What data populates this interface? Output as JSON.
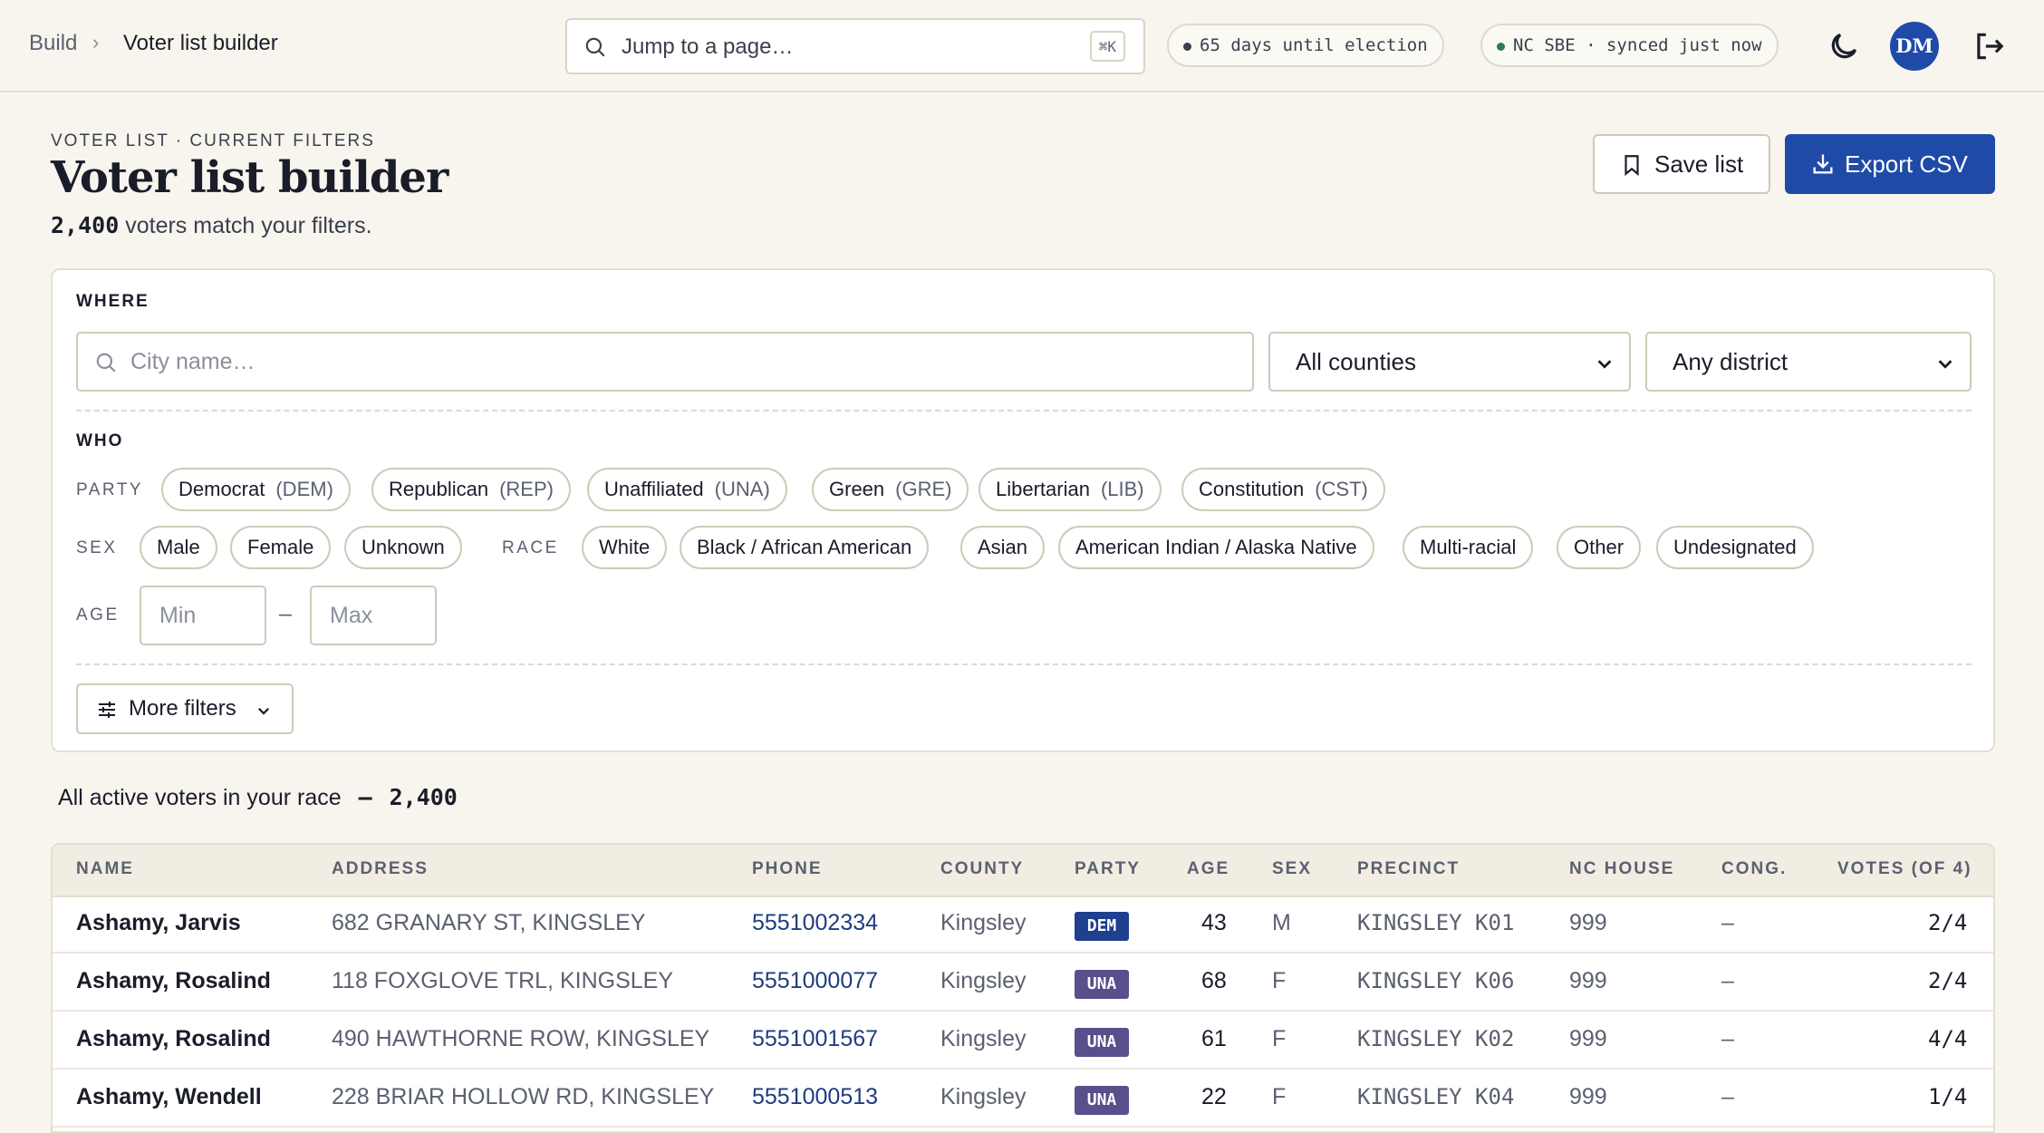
{
  "breadcrumb": {
    "parent": "Build",
    "separator": "›",
    "current": "Voter list builder"
  },
  "search": {
    "placeholder": "Jump to a page…",
    "shortcut": "⌘K"
  },
  "status": {
    "election": "65 days until election",
    "sync": "NC SBE · synced just now"
  },
  "user": {
    "initials": "DM"
  },
  "colors": {
    "accent": "#1f4aa8",
    "dem": "#1f3f8f",
    "una": "#5a4f8c",
    "background": "#f8f5ee"
  },
  "header": {
    "eyebrow": "VOTER LIST · CURRENT FILTERS",
    "title": "Voter list builder",
    "match_count": "2,400",
    "match_text": "voters match your filters.",
    "save_label": "Save list",
    "export_label": "Export CSV"
  },
  "filters": {
    "where_label": "WHERE",
    "city_placeholder": "City name…",
    "county_selected": "All counties",
    "district_selected": "Any district",
    "who_label": "WHO",
    "party_label": "PARTY",
    "parties": [
      {
        "name": "Democrat",
        "abbr": "(DEM)"
      },
      {
        "name": "Republican",
        "abbr": "(REP)"
      },
      {
        "name": "Unaffiliated",
        "abbr": "(UNA)"
      },
      {
        "name": "Green",
        "abbr": "(GRE)"
      },
      {
        "name": "Libertarian",
        "abbr": "(LIB)"
      },
      {
        "name": "Constitution",
        "abbr": "(CST)"
      }
    ],
    "sex_label": "SEX",
    "sexes": [
      "Male",
      "Female",
      "Unknown"
    ],
    "race_label": "RACE",
    "races": [
      "White",
      "Black / African American",
      "Asian",
      "American Indian / Alaska Native",
      "Multi-racial",
      "Other",
      "Undesignated"
    ],
    "age_label": "AGE",
    "age_min_placeholder": "Min",
    "age_max_placeholder": "Max",
    "age_separator": "–",
    "more_filters_label": "More filters"
  },
  "summary": {
    "text": "All active voters in your race",
    "dash": "–",
    "count": "2,400"
  },
  "table": {
    "columns": [
      "NAME",
      "ADDRESS",
      "PHONE",
      "COUNTY",
      "PARTY",
      "AGE",
      "SEX",
      "PRECINCT",
      "NC HOUSE",
      "CONG.",
      "VOTES (OF 4)"
    ],
    "rows": [
      {
        "name": "Ashamy, Jarvis",
        "address": "682 GRANARY ST, KINGSLEY",
        "phone": "5551002334",
        "county": "Kingsley",
        "party": "DEM",
        "age": "43",
        "sex": "M",
        "precinct": "KINGSLEY K01",
        "nc_house": "999",
        "cong": "–",
        "votes": "2/4"
      },
      {
        "name": "Ashamy, Rosalind",
        "address": "118 FOXGLOVE TRL, KINGSLEY",
        "phone": "5551000077",
        "county": "Kingsley",
        "party": "UNA",
        "age": "68",
        "sex": "F",
        "precinct": "KINGSLEY K06",
        "nc_house": "999",
        "cong": "–",
        "votes": "2/4"
      },
      {
        "name": "Ashamy, Rosalind",
        "address": "490 HAWTHORNE ROW, KINGSLEY",
        "phone": "5551001567",
        "county": "Kingsley",
        "party": "UNA",
        "age": "61",
        "sex": "F",
        "precinct": "KINGSLEY K02",
        "nc_house": "999",
        "cong": "–",
        "votes": "4/4"
      },
      {
        "name": "Ashamy, Wendell",
        "address": "228 BRIAR HOLLOW RD, KINGSLEY",
        "phone": "5551000513",
        "county": "Kingsley",
        "party": "UNA",
        "age": "22",
        "sex": "F",
        "precinct": "KINGSLEY K04",
        "nc_house": "999",
        "cong": "–",
        "votes": "1/4"
      }
    ]
  }
}
